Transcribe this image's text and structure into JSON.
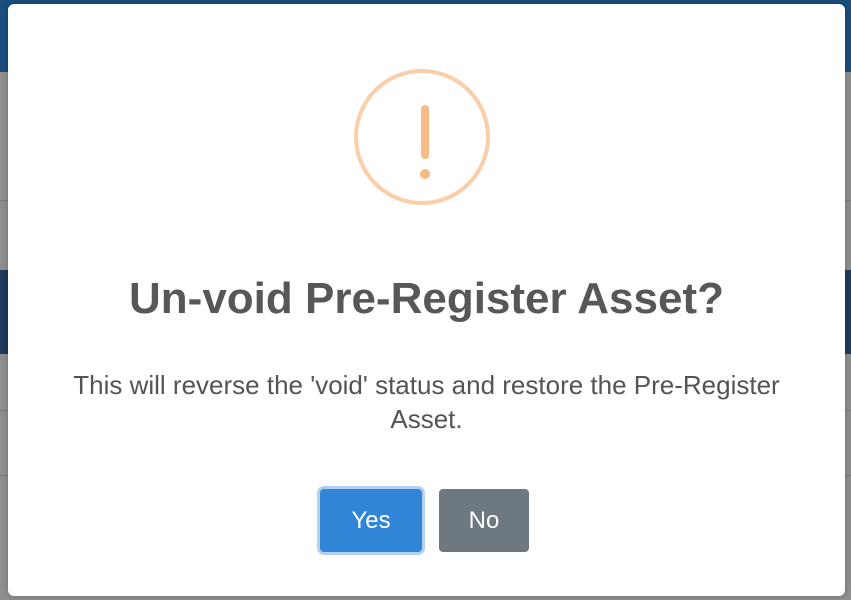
{
  "dialog": {
    "icon": "warning-exclamation-icon",
    "title": "Un-void Pre-Register Asset?",
    "message": "This will reverse the 'void' status and restore the Pre-Register Asset.",
    "confirm_label": "Yes",
    "cancel_label": "No"
  },
  "colors": {
    "warning": "#f8bb86",
    "confirm_button": "#3085d6",
    "cancel_button": "#6e7881",
    "title_text": "#575757"
  }
}
